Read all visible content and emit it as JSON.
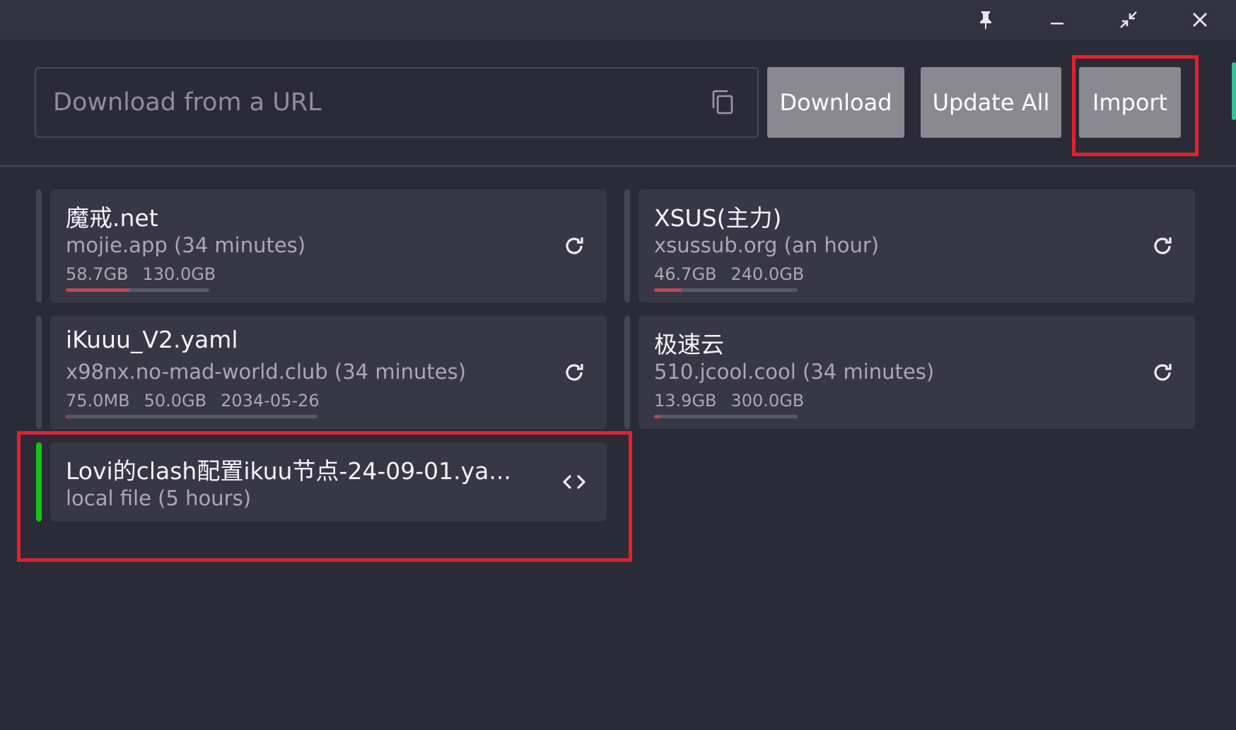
{
  "titlebar": {
    "pin_icon": "pin-icon",
    "minimize_icon": "minimize-icon",
    "restore_icon": "shrink-icon",
    "close_icon": "close-icon"
  },
  "header": {
    "url_placeholder": "Download from a URL",
    "url_value": "",
    "paste_icon": "copy-icon",
    "download_label": "Download",
    "update_all_label": "Update All",
    "import_label": "Import"
  },
  "profiles": [
    {
      "title": "魔戒.net",
      "subtitle": "mojie.app (34 minutes)",
      "used": "58.7GB",
      "total": "130.0GB",
      "expire": "",
      "usage_fraction": 0.45,
      "icon": "refresh-icon",
      "active": false
    },
    {
      "title": "XSUS(主力)",
      "subtitle": "xsussub.org (an hour)",
      "used": "46.7GB",
      "total": "240.0GB",
      "expire": "",
      "usage_fraction": 0.19,
      "icon": "refresh-icon",
      "active": false
    },
    {
      "title": "iKuuu_V2.yaml",
      "subtitle": "x98nx.no-mad-world.club (34 minutes)",
      "used": "75.0MB",
      "total": "50.0GB",
      "expire": "2034-05-26",
      "usage_fraction": 0.0015,
      "icon": "refresh-icon",
      "active": false
    },
    {
      "title": "极速云",
      "subtitle": "510.jcool.cool (34 minutes)",
      "used": "13.9GB",
      "total": "300.0GB",
      "expire": "",
      "usage_fraction": 0.046,
      "icon": "refresh-icon",
      "active": false
    },
    {
      "title": "Lovi的clash配置ikuu节点-24-09-01.ya...",
      "subtitle": "local file (5 hours)",
      "icon": "code-icon",
      "active": true
    }
  ],
  "colors": {
    "background": "#2b2a37",
    "card": "#383744",
    "active_bar": "#17c21a",
    "usage_fill": "#b84a57",
    "highlight": "#e0222e",
    "button": "#8a8990"
  }
}
